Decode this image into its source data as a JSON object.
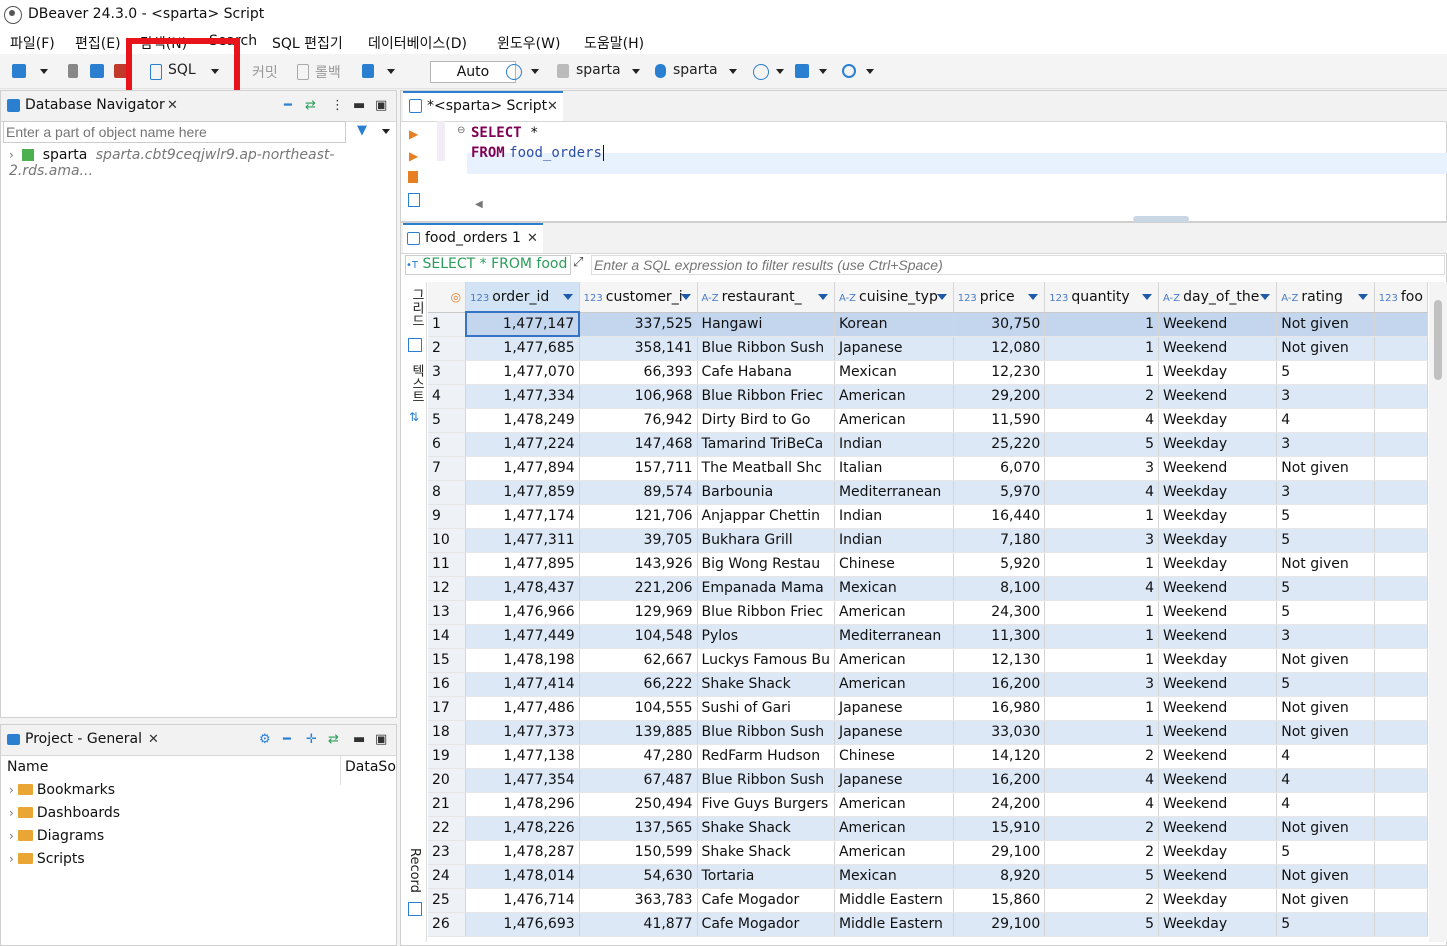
{
  "window": {
    "title": "DBeaver 24.3.0 - <sparta> Script"
  },
  "menu": [
    "파일(F)",
    "편집(E)",
    "탐색(N)",
    "Search",
    "SQL 편집기",
    "데이터베이스(D)",
    "윈도우(W)",
    "도움말(H)"
  ],
  "toolbar": {
    "sql_label": "SQL",
    "commit_label": "커밋",
    "rollback_label": "롤백",
    "mode_value": "Auto",
    "datasource_label": "sparta",
    "schema_label": "sparta"
  },
  "navigator": {
    "title": "Database Navigator",
    "filter_placeholder": "Enter a part of object name here",
    "tree": [
      {
        "name": "sparta",
        "host": "sparta.cbt9ceqjwlr9.ap-northeast-2.rds.ama..."
      }
    ]
  },
  "project": {
    "title": "Project - General",
    "columns": [
      "Name",
      "DataSo"
    ],
    "items": [
      "Bookmarks",
      "Dashboards",
      "Diagrams",
      "Scripts"
    ]
  },
  "editor": {
    "tab_title": "*<sparta> Script",
    "line1_kw": "SELECT",
    "line1_rest": " *",
    "line2_kw": "FROM",
    "line2_rest": "food_orders"
  },
  "results": {
    "tab_title": "food_orders 1",
    "query_text": "SELECT * FROM food",
    "filter_placeholder": "Enter a SQL expression to filter results (use Ctrl+Space)",
    "side_labels": {
      "grid": "그리드",
      "text": "텍스트",
      "record": "Record"
    },
    "columns": [
      {
        "type": "123",
        "name": "order_id"
      },
      {
        "type": "123",
        "name": "customer_i"
      },
      {
        "type": "A-Z",
        "name": "restaurant_"
      },
      {
        "type": "A-Z",
        "name": "cuisine_typ"
      },
      {
        "type": "123",
        "name": "price"
      },
      {
        "type": "123",
        "name": "quantity"
      },
      {
        "type": "A-Z",
        "name": "day_of_the"
      },
      {
        "type": "A-Z",
        "name": "rating"
      },
      {
        "type": "123",
        "name": "foo"
      }
    ],
    "rows": [
      [
        "1",
        "1,477,147",
        "337,525",
        "Hangawi",
        "Korean",
        "30,750",
        "1",
        "Weekend",
        "Not given"
      ],
      [
        "2",
        "1,477,685",
        "358,141",
        "Blue Ribbon Sush",
        "Japanese",
        "12,080",
        "1",
        "Weekend",
        "Not given"
      ],
      [
        "3",
        "1,477,070",
        "66,393",
        "Cafe Habana",
        "Mexican",
        "12,230",
        "1",
        "Weekday",
        "5"
      ],
      [
        "4",
        "1,477,334",
        "106,968",
        "Blue Ribbon Friec",
        "American",
        "29,200",
        "2",
        "Weekend",
        "3"
      ],
      [
        "5",
        "1,478,249",
        "76,942",
        "Dirty Bird to Go",
        "American",
        "11,590",
        "4",
        "Weekday",
        "4"
      ],
      [
        "6",
        "1,477,224",
        "147,468",
        "Tamarind TriBeCa",
        "Indian",
        "25,220",
        "5",
        "Weekday",
        "3"
      ],
      [
        "7",
        "1,477,894",
        "157,711",
        "The Meatball Shc",
        "Italian",
        "6,070",
        "3",
        "Weekend",
        "Not given"
      ],
      [
        "8",
        "1,477,859",
        "89,574",
        "Barbounia",
        "Mediterranean",
        "5,970",
        "4",
        "Weekday",
        "3"
      ],
      [
        "9",
        "1,477,174",
        "121,706",
        "Anjappar Chettin",
        "Indian",
        "16,440",
        "1",
        "Weekday",
        "5"
      ],
      [
        "10",
        "1,477,311",
        "39,705",
        "Bukhara Grill",
        "Indian",
        "7,180",
        "3",
        "Weekday",
        "5"
      ],
      [
        "11",
        "1,477,895",
        "143,926",
        "Big Wong Restau",
        "Chinese",
        "5,920",
        "1",
        "Weekday",
        "Not given"
      ],
      [
        "12",
        "1,478,437",
        "221,206",
        "Empanada Mama",
        "Mexican",
        "8,100",
        "4",
        "Weekend",
        "5"
      ],
      [
        "13",
        "1,476,966",
        "129,969",
        "Blue Ribbon Friec",
        "American",
        "24,300",
        "1",
        "Weekend",
        "5"
      ],
      [
        "14",
        "1,477,449",
        "104,548",
        "Pylos",
        "Mediterranean",
        "11,300",
        "1",
        "Weekend",
        "3"
      ],
      [
        "15",
        "1,478,198",
        "62,667",
        "Luckys Famous Bu",
        "American",
        "12,130",
        "1",
        "Weekday",
        "Not given"
      ],
      [
        "16",
        "1,477,414",
        "66,222",
        "Shake Shack",
        "American",
        "16,200",
        "3",
        "Weekend",
        "5"
      ],
      [
        "17",
        "1,477,486",
        "104,555",
        "Sushi of Gari",
        "Japanese",
        "16,980",
        "1",
        "Weekend",
        "Not given"
      ],
      [
        "18",
        "1,477,373",
        "139,885",
        "Blue Ribbon Sush",
        "Japanese",
        "33,030",
        "1",
        "Weekend",
        "Not given"
      ],
      [
        "19",
        "1,477,138",
        "47,280",
        "RedFarm Hudson",
        "Chinese",
        "14,120",
        "2",
        "Weekend",
        "4"
      ],
      [
        "20",
        "1,477,354",
        "67,487",
        "Blue Ribbon Sush",
        "Japanese",
        "16,200",
        "4",
        "Weekend",
        "4"
      ],
      [
        "21",
        "1,478,296",
        "250,494",
        "Five Guys Burgers",
        "American",
        "24,200",
        "4",
        "Weekend",
        "4"
      ],
      [
        "22",
        "1,478,226",
        "137,565",
        "Shake Shack",
        "American",
        "15,910",
        "2",
        "Weekend",
        "Not given"
      ],
      [
        "23",
        "1,478,287",
        "150,599",
        "Shake Shack",
        "American",
        "29,100",
        "2",
        "Weekday",
        "5"
      ],
      [
        "24",
        "1,478,014",
        "54,630",
        "Tortaria",
        "Mexican",
        "8,920",
        "5",
        "Weekend",
        "Not given"
      ],
      [
        "25",
        "1,476,714",
        "363,783",
        "Cafe Mogador",
        "Middle Eastern",
        "15,860",
        "2",
        "Weekday",
        "Not given"
      ],
      [
        "26",
        "1,476,693",
        "41,877",
        "Cafe Mogador",
        "Middle Eastern",
        "29,100",
        "5",
        "Weekday",
        "5"
      ]
    ]
  },
  "highlight_color": "#e8141c"
}
